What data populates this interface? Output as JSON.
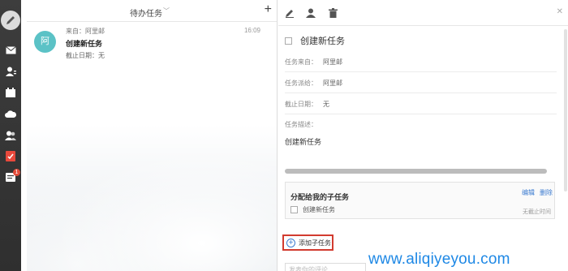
{
  "colors": {
    "rail": "#3a3a3a",
    "avatar": "#5bc2c6",
    "link": "#3b7bd0",
    "highlight_border": "#d23b2f",
    "watermark": "#1e88e5"
  },
  "rail": {
    "icons": [
      "compose-pencil-icon",
      "mail-icon",
      "contacts-icon",
      "calendar-icon",
      "cloud-icon",
      "group-icon",
      "tasks-icon",
      "notes-icon"
    ],
    "badge_count": "1"
  },
  "list": {
    "title": "待办任务",
    "items": [
      {
        "avatar": "阿",
        "from": "来自：阿里邮",
        "time": "16:09",
        "name": "创建新任务",
        "due": "截止日期：无"
      }
    ]
  },
  "detail": {
    "title": "创建新任务",
    "fields": [
      {
        "label": "任务来自：",
        "value": "阿里邮"
      },
      {
        "label": "任务派给：",
        "value": "阿里邮"
      },
      {
        "label": "截止日期：",
        "value": "无"
      }
    ],
    "description_label": "任务描述：",
    "description_value": "创建新任务",
    "subtasks": {
      "title": "分配给我的子任务",
      "edit_label": "编辑",
      "delete_label": "删除",
      "items": [
        {
          "name": "创建新任务",
          "due": "无截止时间"
        }
      ]
    },
    "add_subtask_label": "添加子任务",
    "comment_placeholder": "发表你的评论"
  },
  "watermark": "www.aliqiyeyou.com"
}
